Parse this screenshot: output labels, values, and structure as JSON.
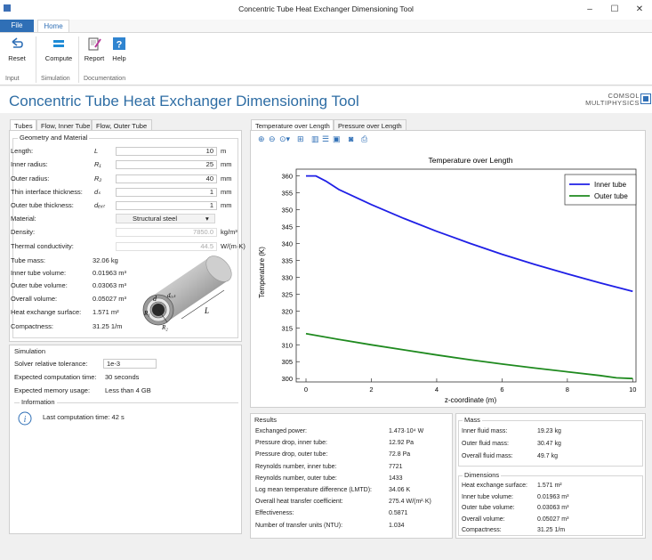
{
  "window": {
    "title": "Concentric Tube Heat Exchanger Dimensioning Tool",
    "minimize": "–",
    "maximize": "☐",
    "close": "✕"
  },
  "menu": {
    "file": "File",
    "home": "Home"
  },
  "ribbon": {
    "buttons": [
      {
        "label": "Reset",
        "icon": "reset-arrow-icon"
      },
      {
        "label": "Compute",
        "icon": "compute-equals-icon"
      },
      {
        "label": "Report",
        "icon": "report-icon"
      },
      {
        "label": "Help",
        "icon": "help-icon"
      }
    ],
    "groups": [
      "Input",
      "Simulation",
      "Documentation"
    ]
  },
  "header": {
    "title": "Concentric Tube Heat Exchanger Dimensioning Tool",
    "brand_line1": "COMSOL",
    "brand_line2": "MULTIPHYSICS"
  },
  "left": {
    "tabs": [
      "Tubes",
      "Flow, Inner Tube",
      "Flow, Outer Tube"
    ],
    "geometry_title": "Geometry and Material",
    "inputs": [
      {
        "label": "Length:",
        "symbol": "L",
        "value": "10",
        "unit": "m"
      },
      {
        "label": "Inner radius:",
        "symbol": "R₁",
        "value": "25",
        "unit": "mm"
      },
      {
        "label": "Outer radius:",
        "symbol": "R₂",
        "value": "40",
        "unit": "mm"
      },
      {
        "label": "Thin interface thickness:",
        "symbol": "dₛ",
        "value": "1",
        "unit": "mm"
      },
      {
        "label": "Outer tube thickness:",
        "symbol": "dₑₓₜ",
        "value": "1",
        "unit": "mm"
      }
    ],
    "material_label": "Material:",
    "material_value": "Structural steel",
    "density_label": "Density:",
    "density_value": "7850.0",
    "density_unit": "kg/m³",
    "conductivity_label": "Thermal conductivity:",
    "conductivity_value": "44.5",
    "conductivity_unit": "W/(m·K)",
    "derived": [
      {
        "label": "Tube mass:",
        "value": "32.06 kg"
      },
      {
        "label": "Inner tube volume:",
        "value": "0.01963 m³"
      },
      {
        "label": "Outer tube volume:",
        "value": "0.03063 m³"
      },
      {
        "label": "Overall volume:",
        "value": "0.05027 m³"
      },
      {
        "label": "Heat exchange surface:",
        "value": "1.571 m²"
      },
      {
        "label": "Compactness:",
        "value": "31.25 1/m"
      }
    ],
    "tube_labels": {
      "d": "d",
      "dext": "dₑₓₜ",
      "L": "L",
      "R1": "R₁",
      "R2": "R₂"
    },
    "simulation_title": "Simulation",
    "solver_label": "Solver relative tolerance:",
    "solver_value": "1e-3",
    "comp_time_label": "Expected computation time:",
    "comp_time_value": "30 seconds",
    "memory_label": "Expected memory usage:",
    "memory_value": "Less than 4 GB",
    "info_title": "Information",
    "info_text": "Last computation time: 42 s"
  },
  "right": {
    "tabs": [
      "Temperature over Length",
      "Pressure over Length"
    ],
    "toolbar_icons": [
      "zoom-in-icon",
      "zoom-out-icon",
      "zoom-box-icon",
      "zoom-extents-icon",
      "grid-icon-1",
      "grid-icon-2",
      "grid-icon-3",
      "camera-icon",
      "print-icon"
    ]
  },
  "chart_data": {
    "type": "line",
    "title": "Temperature over Length",
    "xlabel": "z-coordinate (m)",
    "ylabel": "Temperature (K)",
    "xlim": [
      -0.3,
      10.1
    ],
    "ylim": [
      299,
      362
    ],
    "xticks": [
      "0",
      "2",
      "4",
      "6",
      "8",
      "10"
    ],
    "yticks": [
      "300",
      "305",
      "310",
      "315",
      "320",
      "325",
      "330",
      "335",
      "340",
      "345",
      "350",
      "355",
      "360"
    ],
    "legend_position": "top-right",
    "grid": false,
    "series": [
      {
        "name": "Inner tube",
        "color": "#1f1fe6",
        "x": [
          0,
          0.3,
          0.6,
          1,
          2,
          3,
          4,
          5,
          6,
          7,
          8,
          9,
          10
        ],
        "y": [
          360,
          360,
          358.5,
          356,
          351.5,
          347.4,
          343.6,
          340.1,
          336.8,
          333.8,
          331,
          328.3,
          325.8
        ]
      },
      {
        "name": "Outer tube",
        "color": "#1f8a1f",
        "x": [
          0,
          1,
          2,
          3,
          4,
          5,
          6,
          7,
          8,
          9,
          9.5,
          10
        ],
        "y": [
          313.3,
          311.6,
          310,
          308.5,
          307,
          305.6,
          304.3,
          303.1,
          302,
          300.9,
          300.2,
          300
        ]
      }
    ]
  },
  "results": {
    "title": "Results",
    "rows": [
      {
        "label": "Exchanged power:",
        "value": "1.473·10⁴ W"
      },
      {
        "label": "Pressure drop, inner tube:",
        "value": "12.92 Pa"
      },
      {
        "label": "Pressure drop, outer tube:",
        "value": "72.8 Pa"
      },
      {
        "label": "Reynolds number, inner tube:",
        "value": "7721"
      },
      {
        "label": "Reynolds number, outer tube:",
        "value": "1433"
      },
      {
        "label": "Log mean temperature difference (LMTD):",
        "value": "34.06 K"
      },
      {
        "label": "Overall heat transfer coefficient:",
        "value": "275.4 W/(m²·K)"
      },
      {
        "label": "Effectiveness:",
        "value": "0.5871"
      },
      {
        "label": "Number of transfer units (NTU):",
        "value": "1.034"
      }
    ]
  },
  "mass": {
    "title": "Mass",
    "rows": [
      {
        "label": "Inner fluid mass:",
        "value": "19.23 kg"
      },
      {
        "label": "Outer fluid mass:",
        "value": "30.47 kg"
      },
      {
        "label": "Overall fluid mass:",
        "value": "49.7 kg"
      }
    ]
  },
  "dimensions": {
    "title": "Dimensions",
    "rows": [
      {
        "label": "Heat exchange surface:",
        "value": "1.571 m²"
      },
      {
        "label": "Inner tube volume:",
        "value": "0.01963 m³"
      },
      {
        "label": "Outer tube volume:",
        "value": "0.03063 m³"
      },
      {
        "label": "Overall volume:",
        "value": "0.05027 m³"
      },
      {
        "label": "Compactness:",
        "value": "31.25 1/m"
      }
    ]
  }
}
